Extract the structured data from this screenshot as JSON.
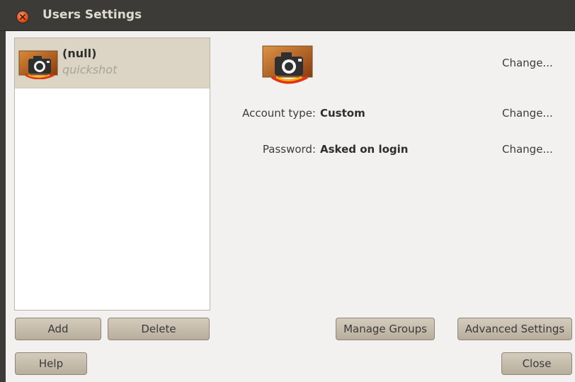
{
  "window": {
    "title": "Users Settings"
  },
  "user": {
    "name": "(null)",
    "login": "quickshot"
  },
  "details": {
    "photo_change": "Change...",
    "account_type_label": "Account type:",
    "account_type_value": "Custom",
    "account_type_change": "Change...",
    "password_label": "Password:",
    "password_value": "Asked on login",
    "password_change": "Change..."
  },
  "buttons": {
    "add": "Add",
    "delete": "Delete",
    "manage_groups": "Manage Groups",
    "advanced_settings": "Advanced Settings",
    "help": "Help",
    "close": "Close"
  },
  "icons": {
    "close": "close-icon",
    "avatar": "camera-icon"
  },
  "colors": {
    "titlebar": "#3c3b37",
    "close_button": "#df4a16",
    "selected_row": "#dcd4c4",
    "button": "#c6bdae"
  }
}
